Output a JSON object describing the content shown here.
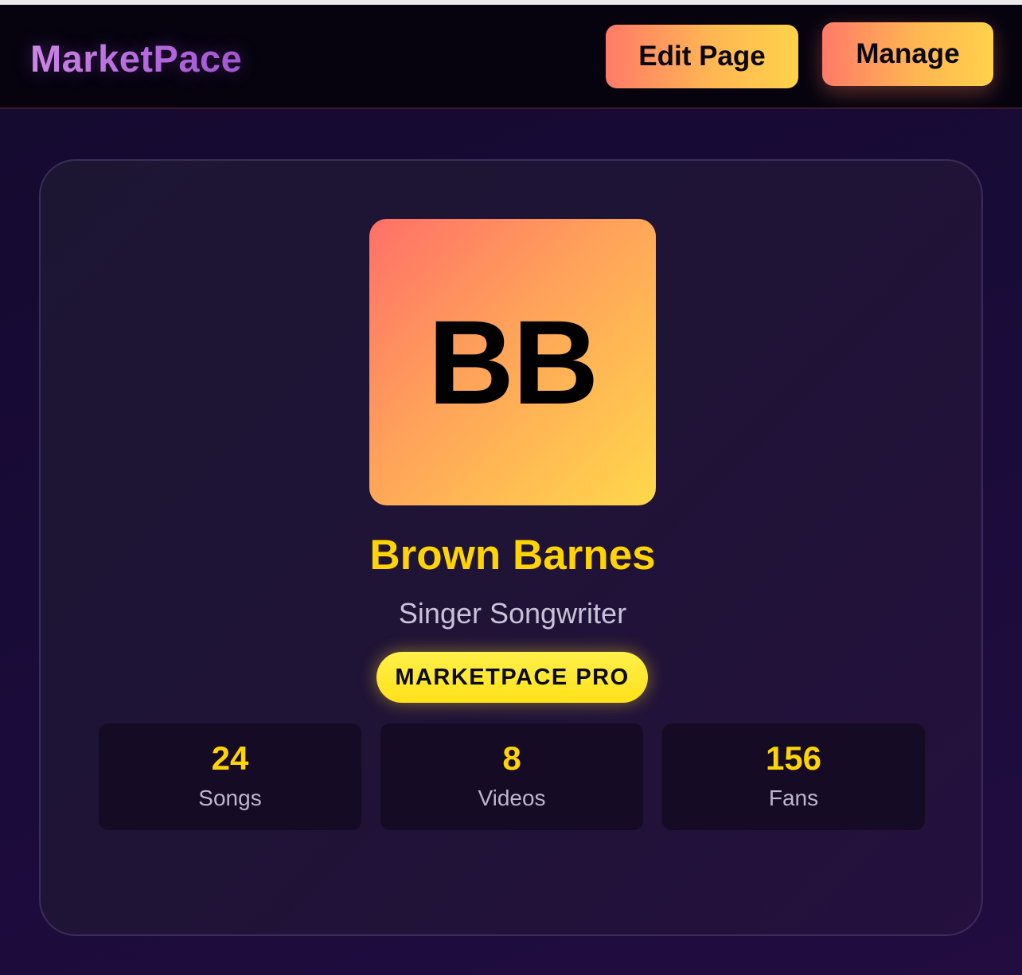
{
  "header": {
    "logo": "MarketPace",
    "edit_button_label": "Edit Page",
    "manage_button_label": "Manage"
  },
  "profile": {
    "initials": "BB",
    "name": "Brown Barnes",
    "role": "Singer Songwriter",
    "badge": "MARKETPACE PRO"
  },
  "stats": [
    {
      "value": "24",
      "label": "Songs"
    },
    {
      "value": "8",
      "label": "Videos"
    },
    {
      "value": "156",
      "label": "Fans"
    }
  ],
  "colors": {
    "accent_yellow": "#ffd400",
    "gradient_start": "#ff7068",
    "gradient_end": "#ffd84a",
    "logo_purple": "#b86ae0",
    "background": "#1a0b3a"
  }
}
